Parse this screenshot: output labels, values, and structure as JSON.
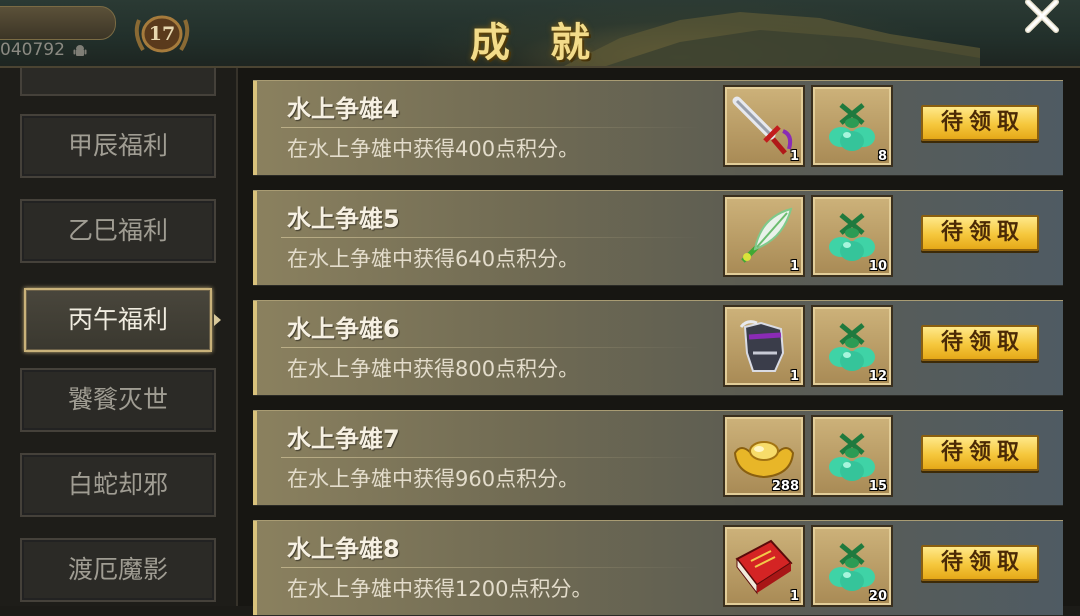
{
  "header": {
    "title": "成就",
    "player_id": "040792",
    "level": "17"
  },
  "sidebar": {
    "items": [
      {
        "label": "甲辰福利",
        "active": false
      },
      {
        "label": "乙巳福利",
        "active": false
      },
      {
        "label": "丙午福利",
        "active": true
      },
      {
        "label": "饕餮灭世",
        "active": false
      },
      {
        "label": "白蛇却邪",
        "active": false
      },
      {
        "label": "渡厄魔影",
        "active": false
      }
    ]
  },
  "achievements": [
    {
      "title": "水上争雄4",
      "description": "在水上争雄中获得400点积分。",
      "rewards": [
        {
          "icon": "sword-icon",
          "count": "1"
        },
        {
          "icon": "jade-pouch-icon",
          "count": "8"
        }
      ],
      "button_label": "待领取"
    },
    {
      "title": "水上争雄5",
      "description": "在水上争雄中获得640点积分。",
      "rewards": [
        {
          "icon": "feather-fan-icon",
          "count": "1"
        },
        {
          "icon": "jade-pouch-icon",
          "count": "10"
        }
      ],
      "button_label": "待领取"
    },
    {
      "title": "水上争雄6",
      "description": "在水上争雄中获得800点积分。",
      "rewards": [
        {
          "icon": "armor-icon",
          "count": "1"
        },
        {
          "icon": "jade-pouch-icon",
          "count": "12"
        }
      ],
      "button_label": "待领取"
    },
    {
      "title": "水上争雄7",
      "description": "在水上争雄中获得960点积分。",
      "rewards": [
        {
          "icon": "gold-ingot-icon",
          "count": "288"
        },
        {
          "icon": "jade-pouch-icon",
          "count": "15"
        }
      ],
      "button_label": "待领取"
    },
    {
      "title": "水上争雄8",
      "description": "在水上争雄中获得1200点积分。",
      "rewards": [
        {
          "icon": "red-book-icon",
          "count": "1"
        },
        {
          "icon": "jade-pouch-icon",
          "count": "20"
        }
      ],
      "button_label": "待领取"
    }
  ],
  "colors": {
    "accent_gold": "#f3dc8a",
    "button_gold": "#f5c73c",
    "jade": "#3fd3a6"
  }
}
